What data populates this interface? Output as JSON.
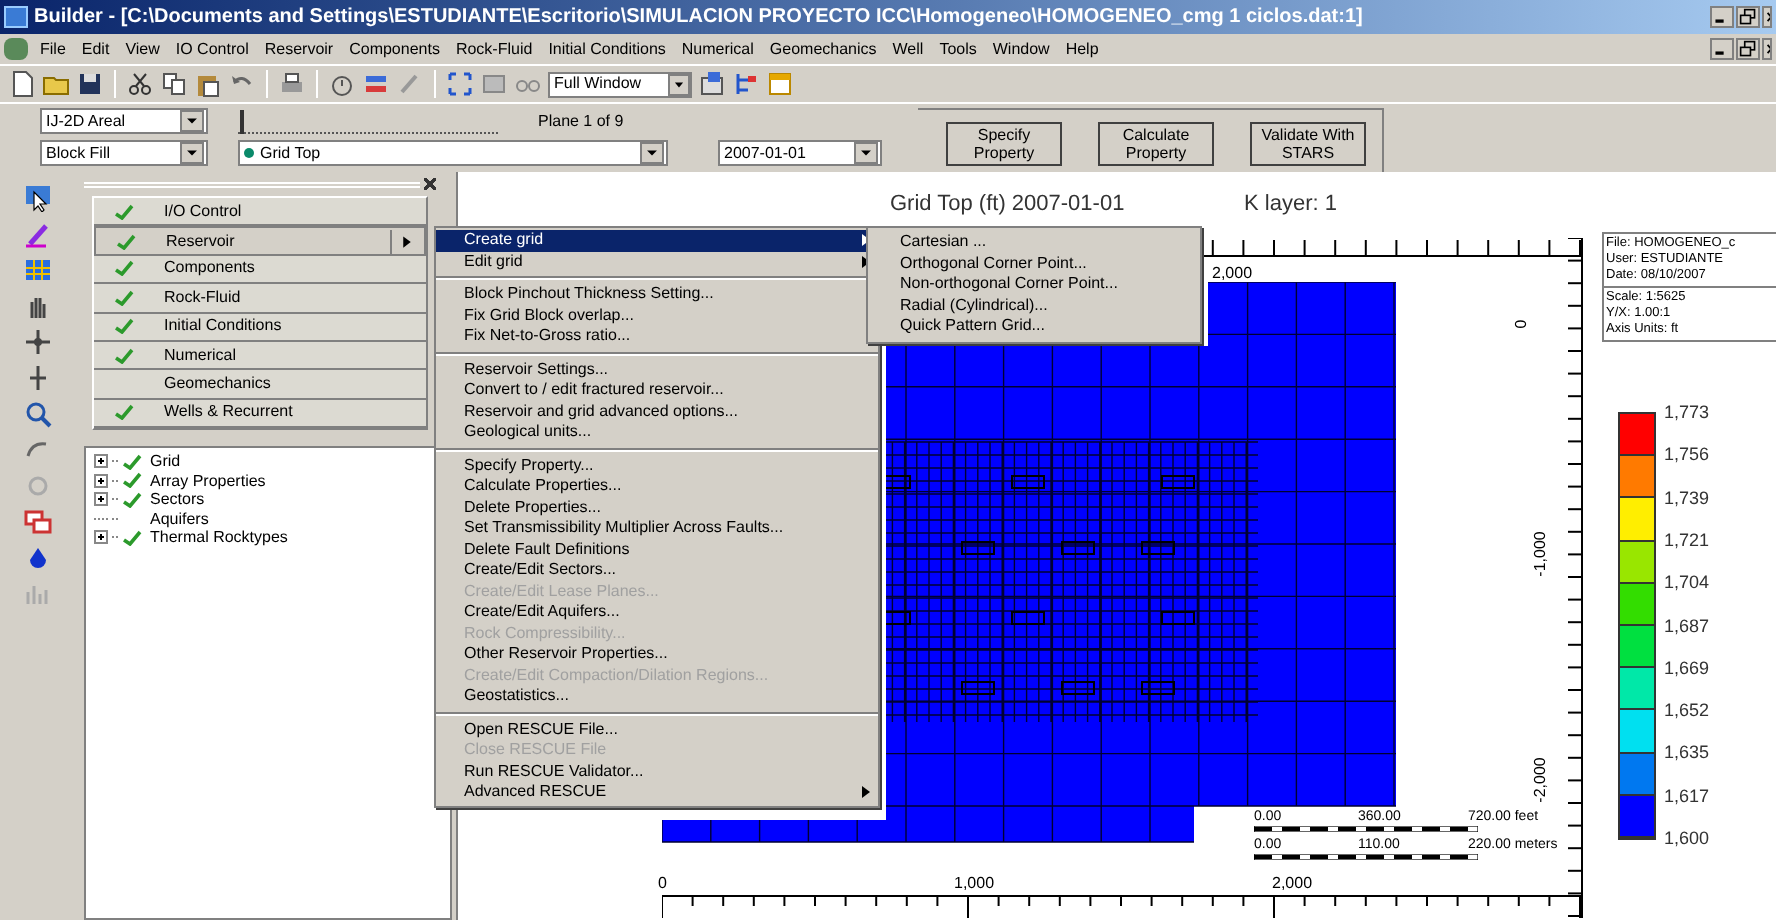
{
  "window": {
    "title": "Builder - [C:\\Documents and Settings\\ESTUDIANTE\\Escritorio\\SIMULACION PROYECTO ICC\\Homogeneo\\HOMOGENEO_cmg 1 ciclos.dat:1]"
  },
  "menu_bar": [
    "File",
    "Edit",
    "View",
    "IO Control",
    "Reservoir",
    "Components",
    "Rock-Fluid",
    "Initial Conditions",
    "Numerical",
    "Geomechanics",
    "Well",
    "Tools",
    "Window",
    "Help"
  ],
  "toolbar": {
    "view_select": "Full Window"
  },
  "controls": {
    "view_mode": "IJ-2D Areal",
    "fill_mode": "Block Fill",
    "plane_label": "Plane 1 of 9",
    "plane_slider": {
      "level": 0
    },
    "property": "Grid Top",
    "date": "2007-01-01",
    "buttons": [
      "Specify Property",
      "Calculate Property",
      "Validate With STARS"
    ]
  },
  "section_menu": [
    {
      "label": "I/O Control",
      "checked": true,
      "selected": false
    },
    {
      "label": "Reservoir",
      "checked": true,
      "selected": true
    },
    {
      "label": "Components",
      "checked": true,
      "selected": false
    },
    {
      "label": "Rock-Fluid",
      "checked": true,
      "selected": false
    },
    {
      "label": "Initial Conditions",
      "checked": true,
      "selected": false
    },
    {
      "label": "Numerical",
      "checked": true,
      "selected": false
    },
    {
      "label": "Geomechanics",
      "checked": false,
      "selected": false
    },
    {
      "label": "Wells & Recurrent",
      "checked": true,
      "selected": false
    }
  ],
  "tree": [
    {
      "label": "Grid",
      "checked": true,
      "expandable": true
    },
    {
      "label": "Array Properties",
      "checked": true,
      "expandable": true
    },
    {
      "label": "Sectors",
      "checked": true,
      "expandable": true
    },
    {
      "label": "Aquifers",
      "checked": false,
      "expandable": false
    },
    {
      "label": "Thermal Rocktypes",
      "checked": true,
      "expandable": true
    }
  ],
  "reservoir_menu": [
    [
      {
        "label": "Create grid",
        "submenu": true,
        "selected": true,
        "disabled": false
      },
      {
        "label": "Edit grid",
        "submenu": true,
        "selected": false,
        "disabled": false
      }
    ],
    [
      {
        "label": "Block Pinchout Thickness Setting...",
        "submenu": false,
        "selected": false,
        "disabled": false
      },
      {
        "label": "Fix Grid Block overlap...",
        "submenu": false,
        "selected": false,
        "disabled": false
      },
      {
        "label": "Fix Net-to-Gross ratio...",
        "submenu": false,
        "selected": false,
        "disabled": false
      }
    ],
    [
      {
        "label": "Reservoir Settings...",
        "submenu": false,
        "selected": false,
        "disabled": false
      },
      {
        "label": "Convert to / edit fractured reservoir...",
        "submenu": false,
        "selected": false,
        "disabled": false
      },
      {
        "label": "Reservoir and grid advanced options...",
        "submenu": false,
        "selected": false,
        "disabled": false
      },
      {
        "label": "Geological units...",
        "submenu": false,
        "selected": false,
        "disabled": false
      }
    ],
    [
      {
        "label": "Specify Property...",
        "submenu": false,
        "selected": false,
        "disabled": false
      },
      {
        "label": "Calculate Properties...",
        "submenu": false,
        "selected": false,
        "disabled": false
      },
      {
        "label": "Delete Properties...",
        "submenu": false,
        "selected": false,
        "disabled": false
      },
      {
        "label": "Set Transmissibility Multiplier Across Faults...",
        "submenu": false,
        "selected": false,
        "disabled": false
      },
      {
        "label": "Delete Fault Definitions",
        "submenu": false,
        "selected": false,
        "disabled": false
      },
      {
        "label": "Create/Edit Sectors...",
        "submenu": false,
        "selected": false,
        "disabled": false
      },
      {
        "label": "Create/Edit Lease Planes...",
        "submenu": false,
        "selected": false,
        "disabled": true
      },
      {
        "label": "Create/Edit Aquifers...",
        "submenu": false,
        "selected": false,
        "disabled": false
      },
      {
        "label": "Rock Compressibility...",
        "submenu": false,
        "selected": false,
        "disabled": true
      },
      {
        "label": "Other Reservoir Properties...",
        "submenu": false,
        "selected": false,
        "disabled": false
      },
      {
        "label": "Create/Edit Compaction/Dilation Regions...",
        "submenu": false,
        "selected": false,
        "disabled": true
      },
      {
        "label": "Geostatistics...",
        "submenu": false,
        "selected": false,
        "disabled": false
      }
    ],
    [
      {
        "label": "Open RESCUE File...",
        "submenu": false,
        "selected": false,
        "disabled": false
      },
      {
        "label": "Close RESCUE File",
        "submenu": false,
        "selected": false,
        "disabled": true
      },
      {
        "label": "Run RESCUE Validator...",
        "submenu": false,
        "selected": false,
        "disabled": false
      },
      {
        "label": "Advanced RESCUE",
        "submenu": true,
        "selected": false,
        "disabled": false
      }
    ]
  ],
  "create_grid_submenu": [
    "Cartesian ...",
    "Orthogonal Corner Point...",
    "Non-orthogonal Corner Point...",
    "Radial (Cylindrical)...",
    "Quick Pattern Grid..."
  ],
  "plot": {
    "title": "Grid Top (ft) 2007-01-01",
    "layer": "K layer: 1",
    "top_axis_label": "2,000",
    "x_axis_labels": [
      "0",
      "1,000",
      "2,000"
    ],
    "y_axis_labels": [
      "0",
      "-1,000",
      "-2,000"
    ],
    "info": [
      [
        "File: HOMOGENEO_c",
        "User:  ESTUDIANTE",
        "Date: 08/10/2007"
      ],
      [
        "Scale: 1:5625",
        "Y/X: 1.00:1",
        "Axis Units: ft"
      ]
    ],
    "scale_bar": [
      [
        "0.00",
        "360.00",
        "720.00 feet"
      ],
      [
        "0.00",
        "110.00",
        "220.00 meters"
      ]
    ],
    "legend_labels": [
      "1,773",
      "1,756",
      "1,739",
      "1,721",
      "1,704",
      "1,687",
      "1,669",
      "1,652",
      "1,635",
      "1,617",
      "1,600"
    ],
    "legend_bands": [
      {
        "color": "#ff0000"
      },
      {
        "color": "#ff7a00"
      },
      {
        "color": "#ffee00"
      },
      {
        "color": "#99e600"
      },
      {
        "color": "#33dd00"
      },
      {
        "color": "#00e040"
      },
      {
        "color": "#00e8a8"
      },
      {
        "color": "#00e0f0"
      },
      {
        "color": "#0078f0"
      },
      {
        "color": "#0000ff"
      }
    ]
  }
}
